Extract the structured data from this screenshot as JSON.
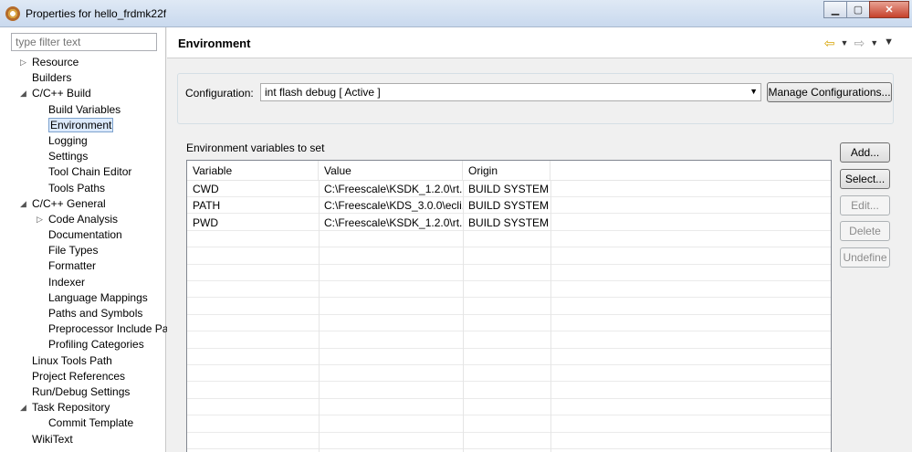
{
  "window": {
    "title": "Properties for hello_frdmk22f"
  },
  "filter": {
    "placeholder": "type filter text"
  },
  "tree": [
    {
      "label": "Resource",
      "level": 0,
      "twisty": "collapsed"
    },
    {
      "label": "Builders",
      "level": 0
    },
    {
      "label": "C/C++ Build",
      "level": 0,
      "twisty": "expanded"
    },
    {
      "label": "Build Variables",
      "level": 1
    },
    {
      "label": "Environment",
      "level": 1,
      "selected": true
    },
    {
      "label": "Logging",
      "level": 1
    },
    {
      "label": "Settings",
      "level": 1
    },
    {
      "label": "Tool Chain Editor",
      "level": 1
    },
    {
      "label": "Tools Paths",
      "level": 1
    },
    {
      "label": "C/C++ General",
      "level": 0,
      "twisty": "expanded"
    },
    {
      "label": "Code Analysis",
      "level": 1,
      "twisty": "collapsed"
    },
    {
      "label": "Documentation",
      "level": 1
    },
    {
      "label": "File Types",
      "level": 1
    },
    {
      "label": "Formatter",
      "level": 1
    },
    {
      "label": "Indexer",
      "level": 1
    },
    {
      "label": "Language Mappings",
      "level": 1
    },
    {
      "label": "Paths and Symbols",
      "level": 1
    },
    {
      "label": "Preprocessor Include Pa",
      "level": 1
    },
    {
      "label": "Profiling Categories",
      "level": 1
    },
    {
      "label": "Linux Tools Path",
      "level": 0
    },
    {
      "label": "Project References",
      "level": 0
    },
    {
      "label": "Run/Debug Settings",
      "level": 0
    },
    {
      "label": "Task Repository",
      "level": 0,
      "twisty": "expanded"
    },
    {
      "label": "Commit Template",
      "level": 1
    },
    {
      "label": "WikiText",
      "level": 0
    }
  ],
  "page": {
    "title": "Environment"
  },
  "config": {
    "label": "Configuration:",
    "selected": "int flash debug  [ Active ]",
    "manage_label": "Manage Configurations..."
  },
  "env": {
    "label": "Environment variables to set",
    "columns": [
      "Variable",
      "Value",
      "Origin"
    ],
    "rows": [
      [
        "CWD",
        "C:\\Freescale\\KSDK_1.2.0\\rt...",
        "BUILD SYSTEM"
      ],
      [
        "PATH",
        "C:\\Freescale\\KDS_3.0.0\\ecli...",
        "BUILD SYSTEM"
      ],
      [
        "PWD",
        "C:\\Freescale\\KSDK_1.2.0\\rt...",
        "BUILD SYSTEM"
      ]
    ]
  },
  "buttons": {
    "add": "Add...",
    "select": "Select...",
    "edit": "Edit...",
    "delete": "Delete",
    "undefine": "Undefine"
  },
  "icons": {
    "back": "nav-back-arrow-icon",
    "forward": "nav-forward-arrow-icon",
    "menu": "view-menu-icon"
  },
  "colors": {
    "selection_bg": "#dceafc",
    "selection_border": "#7da2ce",
    "back_arrow": "#d6a200"
  }
}
